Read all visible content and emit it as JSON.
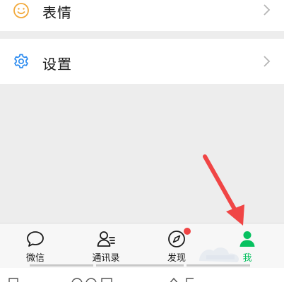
{
  "rows": {
    "stickers": {
      "label": "表情"
    },
    "settings": {
      "label": "设置"
    }
  },
  "tabs": [
    {
      "label": "微信",
      "icon": "chat-bubble-icon"
    },
    {
      "label": "通讯录",
      "icon": "contacts-icon"
    },
    {
      "label": "发现",
      "icon": "compass-icon",
      "badge": true
    },
    {
      "label": "我",
      "icon": "person-icon",
      "active": true
    }
  ],
  "colors": {
    "accent": "#07c160",
    "settings_icon": "#2f8df0",
    "stickers_icon": "#f2a93b",
    "badge": "#f04545",
    "annotation_arrow": "#f04545"
  }
}
